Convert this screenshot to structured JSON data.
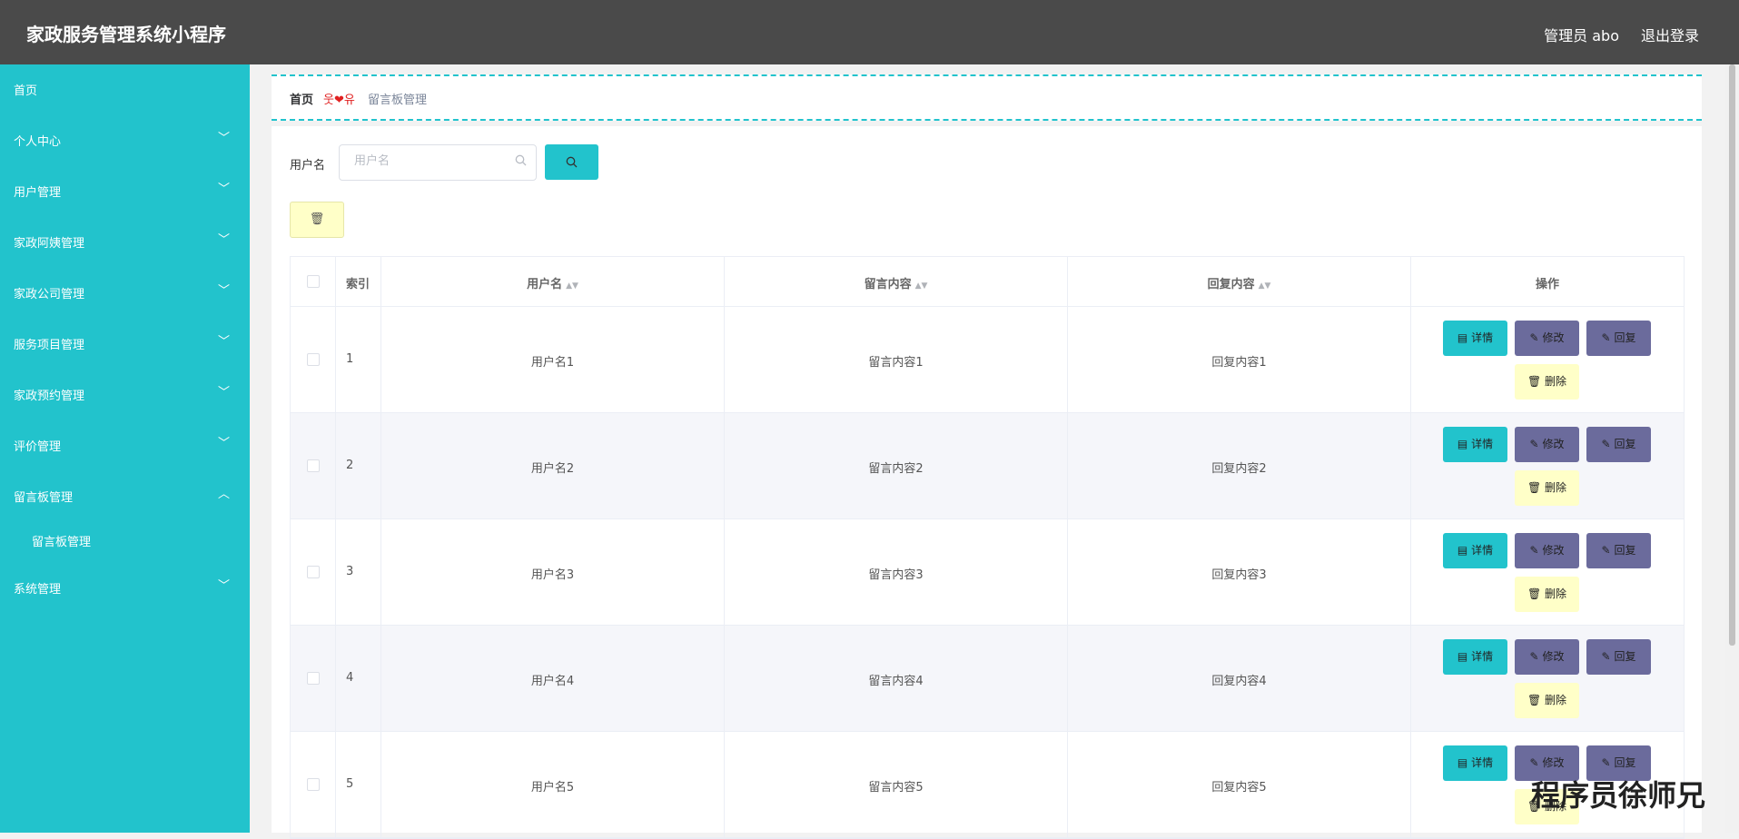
{
  "header": {
    "title": "家政服务管理系统小程序",
    "admin": "管理员 abo",
    "logout": "退出登录"
  },
  "sidebar": {
    "items": [
      {
        "label": "首页",
        "chevron": ""
      },
      {
        "label": "个人中心",
        "chevron": "﹀"
      },
      {
        "label": "用户管理",
        "chevron": "﹀"
      },
      {
        "label": "家政阿姨管理",
        "chevron": "﹀"
      },
      {
        "label": "家政公司管理",
        "chevron": "﹀"
      },
      {
        "label": "服务项目管理",
        "chevron": "﹀"
      },
      {
        "label": "家政预约管理",
        "chevron": "﹀"
      },
      {
        "label": "评价管理",
        "chevron": "﹀"
      },
      {
        "label": "留言板管理",
        "chevron": "︿"
      },
      {
        "label": "系统管理",
        "chevron": "﹀"
      }
    ],
    "subitem": "留言板管理"
  },
  "breadcrumb": {
    "home": "首页",
    "separator": "웃❤유",
    "current": "留言板管理"
  },
  "search": {
    "label": "用户名",
    "placeholder": "用户名",
    "button_icon": "search-icon"
  },
  "table": {
    "headers": {
      "index": "索引",
      "username": "用户名",
      "message": "留言内容",
      "reply": "回复内容",
      "ops": "操作"
    },
    "rows": [
      {
        "index": "1",
        "username": "用户名1",
        "message": "留言内容1",
        "reply": "回复内容1"
      },
      {
        "index": "2",
        "username": "用户名2",
        "message": "留言内容2",
        "reply": "回复内容2"
      },
      {
        "index": "3",
        "username": "用户名3",
        "message": "留言内容3",
        "reply": "回复内容3"
      },
      {
        "index": "4",
        "username": "用户名4",
        "message": "留言内容4",
        "reply": "回复内容4"
      },
      {
        "index": "5",
        "username": "用户名5",
        "message": "留言内容5",
        "reply": "回复内容5"
      }
    ],
    "actions": {
      "detail": "详情",
      "edit": "修改",
      "reply": "回复",
      "delete": "删除"
    }
  },
  "watermark": "程序员徐师兄",
  "colors": {
    "primary": "#22c3cc",
    "header": "#4a4a4a",
    "edit": "#6b6b9c",
    "delete": "#ffffc8"
  }
}
